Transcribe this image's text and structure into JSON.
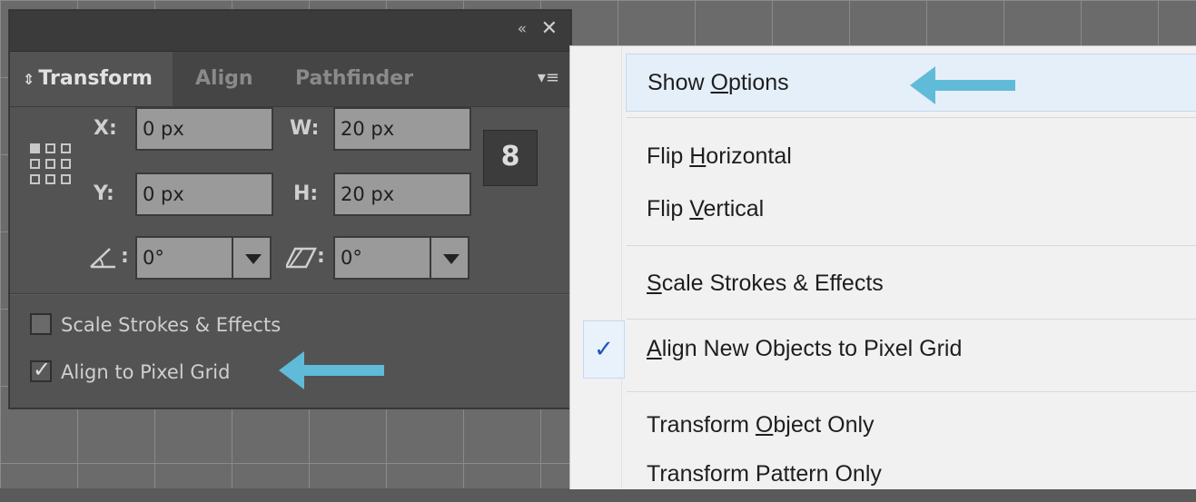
{
  "panel": {
    "collapse_icon": "«",
    "close_icon": "✕",
    "tabs": [
      {
        "label": "Transform",
        "active": true
      },
      {
        "label": "Align",
        "active": false
      },
      {
        "label": "Pathfinder",
        "active": false
      }
    ],
    "tab_arrows": "⇕",
    "menu_icon": "▾≡",
    "fields": {
      "x_label": "X:",
      "x_value": "0 px",
      "y_label": "Y:",
      "y_value": "0 px",
      "w_label": "W:",
      "w_value": "20 px",
      "h_label": "H:",
      "h_value": "20 px",
      "rotate_value": "0°",
      "shear_value": "0°"
    },
    "link_icon": "8",
    "checkboxes": [
      {
        "label": "Scale Strokes & Effects",
        "checked": false
      },
      {
        "label": "Align to Pixel Grid",
        "checked": true
      }
    ],
    "check_mark": "✓"
  },
  "menu": {
    "check_mark": "✓",
    "items": [
      {
        "pre": "Show ",
        "key": "O",
        "post": "ptions"
      },
      {
        "pre": "Flip ",
        "key": "H",
        "post": "orizontal"
      },
      {
        "pre": "Flip ",
        "key": "V",
        "post": "ertical"
      },
      {
        "pre": "",
        "key": "S",
        "post": "cale Strokes & Effects"
      },
      {
        "pre": "",
        "key": "A",
        "post": "lign New Objects to Pixel Grid"
      },
      {
        "pre": "Transform ",
        "key": "O",
        "post": "bject Only"
      },
      {
        "pre": "Transform Pattern Only",
        "key": "",
        "post": ""
      }
    ]
  },
  "colors": {
    "arrow": "#60bbd8",
    "menu_highlight": "#e5eff9",
    "check_blue": "#1a56b8"
  }
}
